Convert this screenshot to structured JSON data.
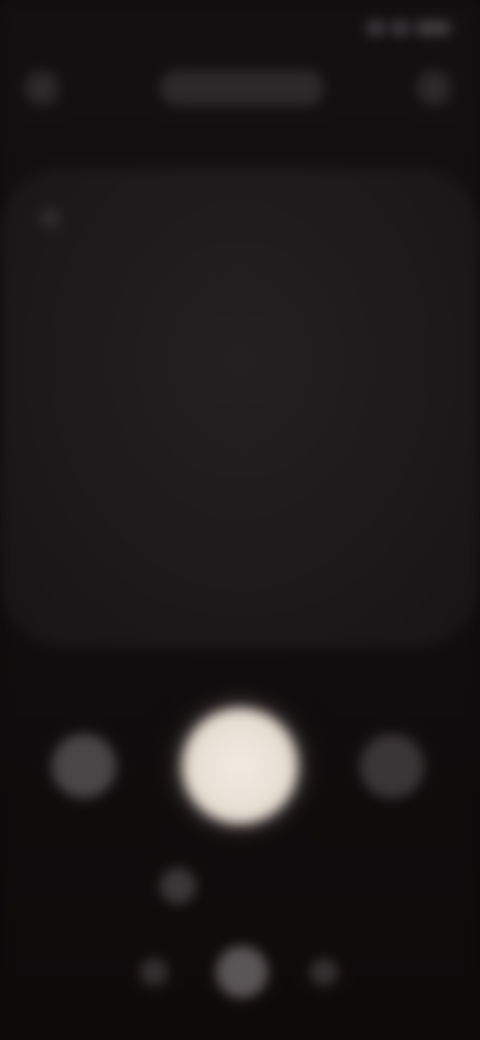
{
  "status_bar": {
    "time": "",
    "icons": [
      "wifi-icon",
      "signal-icon",
      "battery-icon"
    ]
  },
  "top_bar": {
    "left_icon": "back-icon",
    "title": "",
    "right_icon": "more-icon"
  },
  "viewfinder": {
    "marker_icon": "focus-icon"
  },
  "controls": {
    "left_button": "gallery-thumbnail",
    "shutter": "shutter-button",
    "right_button": "switch-camera"
  },
  "mode": {
    "icon": "mode-icon",
    "label": ""
  },
  "bottom_switcher": {
    "items": [
      "option-1",
      "option-2",
      "option-3"
    ]
  },
  "colors": {
    "background": "#0d0b0c",
    "shutter": "#f2ebe3"
  }
}
